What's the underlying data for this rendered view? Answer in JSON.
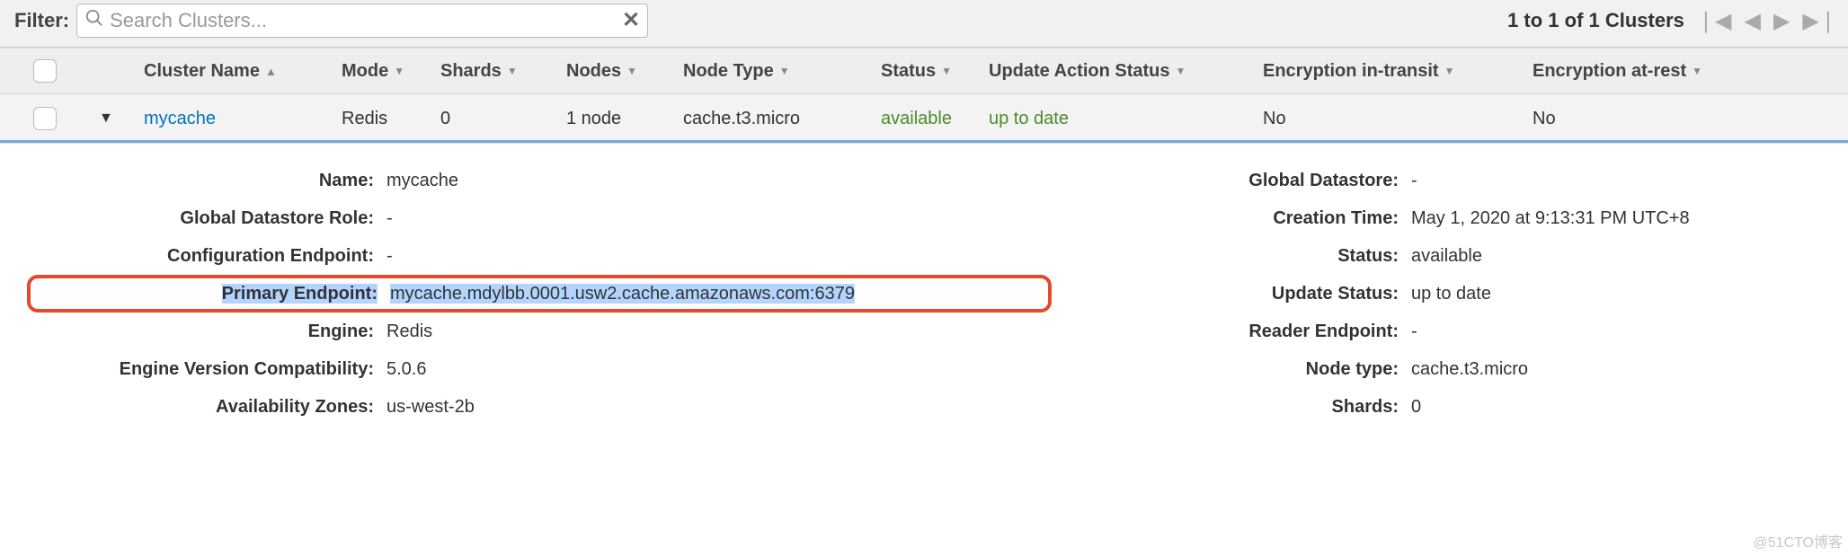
{
  "toolbar": {
    "filter_label": "Filter:",
    "search_placeholder": "Search Clusters...",
    "pager_text": "1 to 1 of 1 Clusters"
  },
  "columns": {
    "name": "Cluster Name",
    "mode": "Mode",
    "shards": "Shards",
    "nodes": "Nodes",
    "node_type": "Node Type",
    "status": "Status",
    "update_status": "Update Action Status",
    "enc_transit": "Encryption in-transit",
    "enc_rest": "Encryption at-rest"
  },
  "row": {
    "name": "mycache",
    "mode": "Redis",
    "shards": "0",
    "nodes": "1 node",
    "node_type": "cache.t3.micro",
    "status": "available",
    "update_status": "up to date",
    "enc_transit": "No",
    "enc_rest": "No"
  },
  "details": {
    "left": {
      "name_label": "Name:",
      "name_value": "mycache",
      "gds_role_label": "Global Datastore Role:",
      "gds_role_value": "-",
      "config_ep_label": "Configuration Endpoint:",
      "config_ep_value": "-",
      "primary_ep_label": "Primary Endpoint:",
      "primary_ep_value": "mycache.mdylbb.0001.usw2.cache.amazonaws.com:6379",
      "engine_label": "Engine:",
      "engine_value": "Redis",
      "engine_ver_label": "Engine Version Compatibility:",
      "engine_ver_value": "5.0.6",
      "az_label": "Availability Zones:",
      "az_value": "us-west-2b"
    },
    "right": {
      "gds_label": "Global Datastore:",
      "gds_value": "-",
      "creation_label": "Creation Time:",
      "creation_value": "May 1, 2020 at 9:13:31 PM UTC+8",
      "status_label": "Status:",
      "status_value": "available",
      "update_label": "Update Status:",
      "update_value": "up to date",
      "reader_ep_label": "Reader Endpoint:",
      "reader_ep_value": "-",
      "node_type_label": "Node type:",
      "node_type_value": "cache.t3.micro",
      "shards_label": "Shards:",
      "shards_value": "0"
    }
  },
  "watermark": "@51CTO博客"
}
